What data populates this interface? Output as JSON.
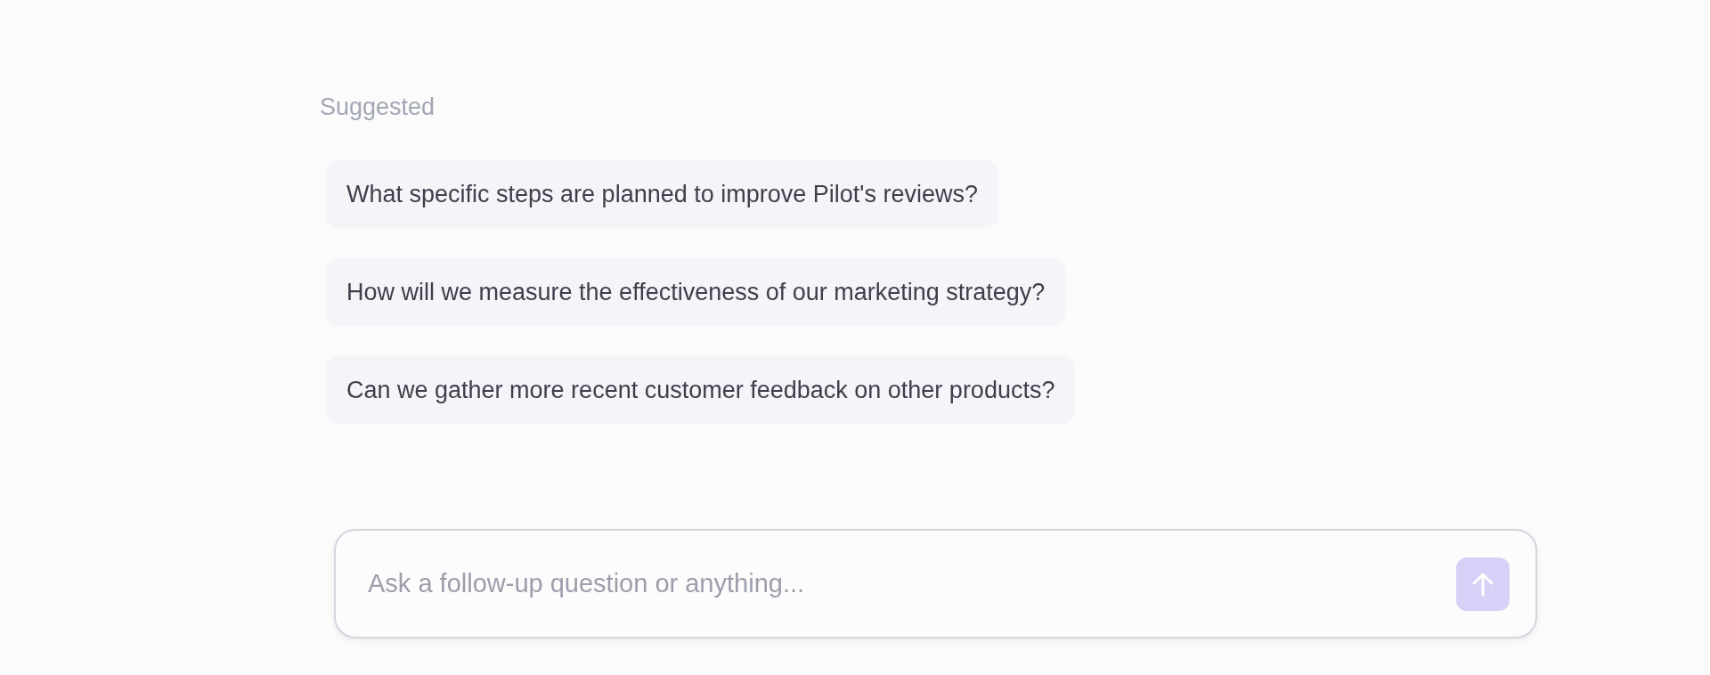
{
  "suggested": {
    "label": "Suggested",
    "items": [
      {
        "text": "What specific steps are planned to improve Pilot's reviews?"
      },
      {
        "text": "How will we measure the effectiveness of our marketing strategy?"
      },
      {
        "text": "Can we gather more recent customer feedback on other products?"
      }
    ]
  },
  "composer": {
    "placeholder": "Ask a follow-up question or anything...",
    "send_button": {
      "disabled": true
    }
  }
}
